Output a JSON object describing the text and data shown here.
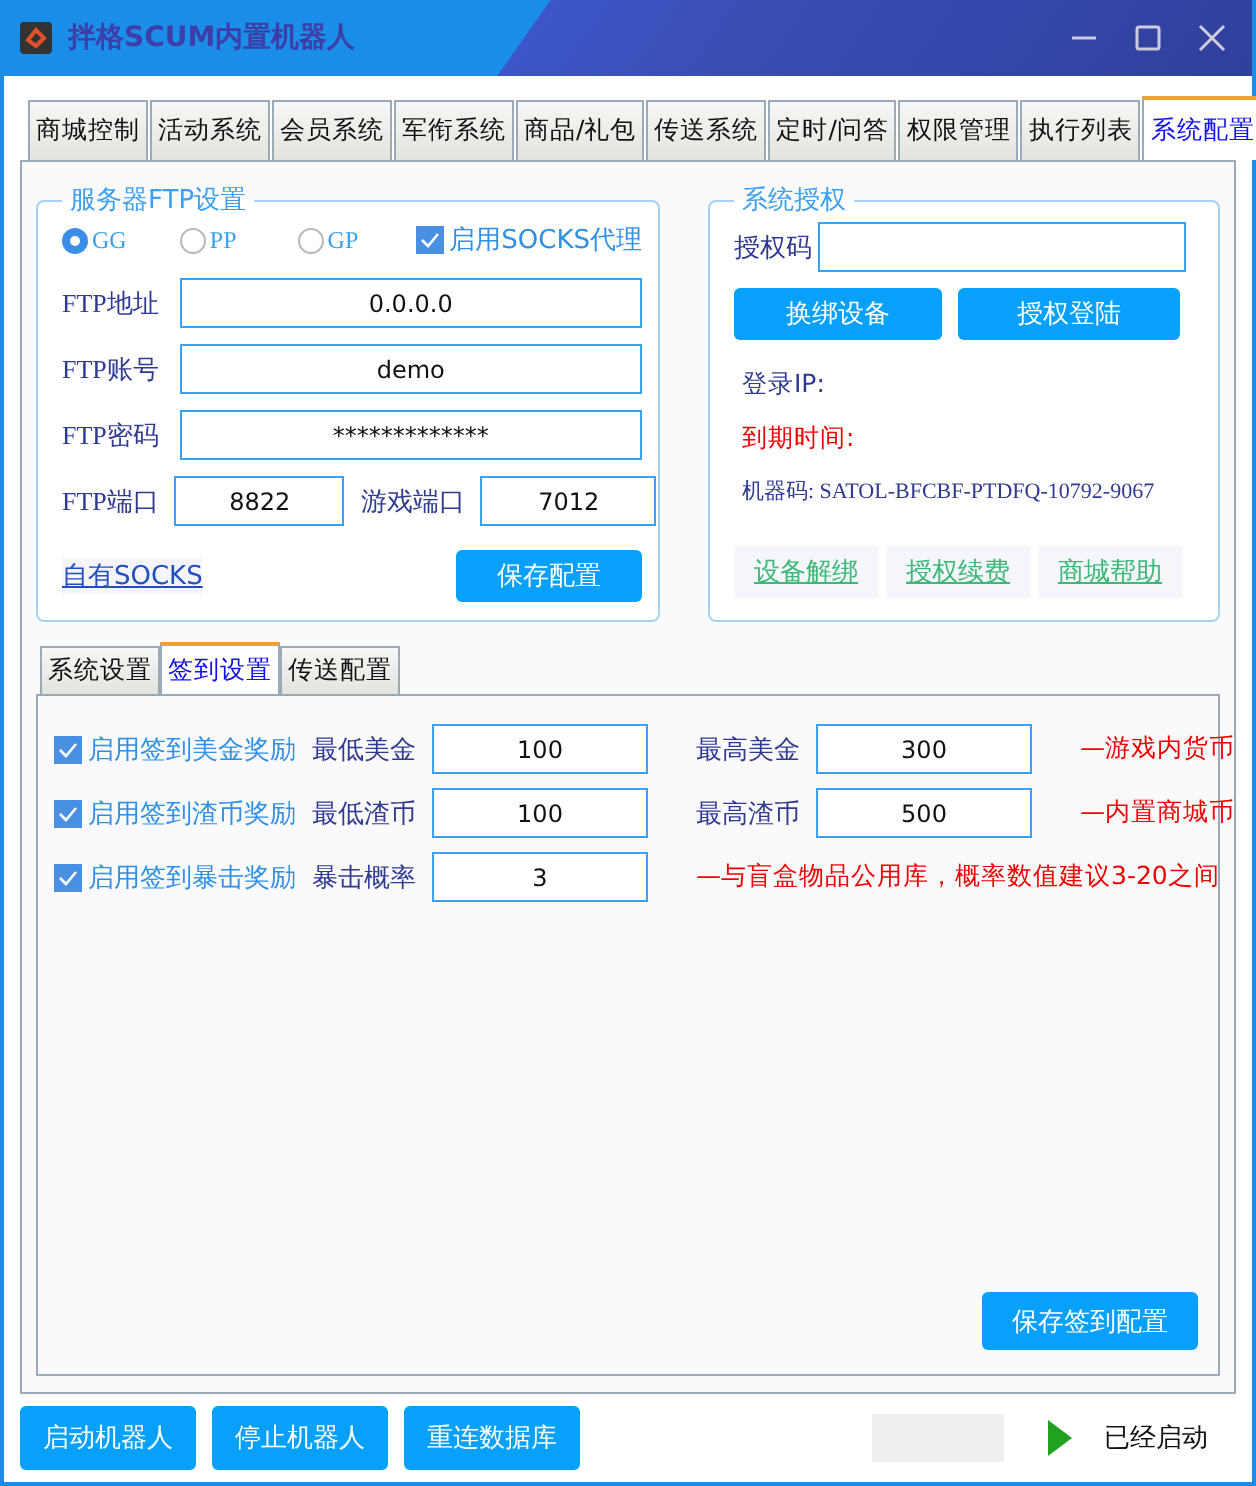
{
  "window": {
    "title": "拌格SCUM内置机器人"
  },
  "tabs": [
    {
      "label": "商城控制",
      "selected": false
    },
    {
      "label": "活动系统",
      "selected": false
    },
    {
      "label": "会员系统",
      "selected": false
    },
    {
      "label": "军衔系统",
      "selected": false
    },
    {
      "label": "商品/礼包",
      "selected": false
    },
    {
      "label": "传送系统",
      "selected": false
    },
    {
      "label": "定时/问答",
      "selected": false
    },
    {
      "label": "权限管理",
      "selected": false
    },
    {
      "label": "执行列表",
      "selected": false
    },
    {
      "label": "系统配置",
      "selected": true
    }
  ],
  "ftp": {
    "title": "服务器FTP设置",
    "modes": [
      {
        "label": "GG",
        "selected": true
      },
      {
        "label": "PP",
        "selected": false
      },
      {
        "label": "GP",
        "selected": false
      }
    ],
    "socks_proxy": {
      "label": "启用SOCKS代理",
      "checked": true
    },
    "fields": [
      {
        "label": "FTP地址",
        "value": "0.0.0.0"
      },
      {
        "label": "FTP账号",
        "value": "demo"
      },
      {
        "label": "FTP密码",
        "value": "*************"
      }
    ],
    "port": {
      "label": "FTP端口",
      "value": "8822"
    },
    "game_port": {
      "label": "游戏端口",
      "value": "7012"
    },
    "link": "自有SOCKS",
    "save": "保存配置"
  },
  "auth": {
    "title": "系统授权",
    "code_label": "授权码",
    "buttons": [
      "换绑设备",
      "授权登陆"
    ],
    "login_ip": "登录IP:",
    "expiry": "到期时间:",
    "machine_code": "机器码: SATOL-BFCBF-PTDFQ-10792-9067",
    "links": [
      "设备解绑",
      "授权续费",
      "商城帮助"
    ]
  },
  "sub_tabs": [
    {
      "label": "系统设置",
      "selected": false
    },
    {
      "label": "签到设置",
      "selected": true
    },
    {
      "label": "传送配置",
      "selected": false
    }
  ],
  "signin_rows": [
    {
      "label": "启用签到美金奖励",
      "checked": true,
      "fields": [
        {
          "label": "最低美金",
          "value": "100"
        },
        {
          "label": "最高美金",
          "value": "300"
        }
      ],
      "note": "—游戏内货币"
    },
    {
      "label": "启用签到渣币奖励",
      "checked": true,
      "fields": [
        {
          "label": "最低渣币",
          "value": "100"
        },
        {
          "label": "最高渣币",
          "value": "500"
        }
      ],
      "note": "—内置商城币"
    },
    {
      "label": "启用签到暴击奖励",
      "checked": true,
      "fields": [
        {
          "label": "暴击概率",
          "value": "3"
        }
      ],
      "note": "—与盲盒物品公用库，概率数值建议3-20之间"
    }
  ],
  "save_signin": "保存签到配置",
  "bottom_buttons": [
    "启动机器人",
    "停止机器人",
    "重连数据库"
  ],
  "status": {
    "running": true,
    "text": "已经启动"
  }
}
